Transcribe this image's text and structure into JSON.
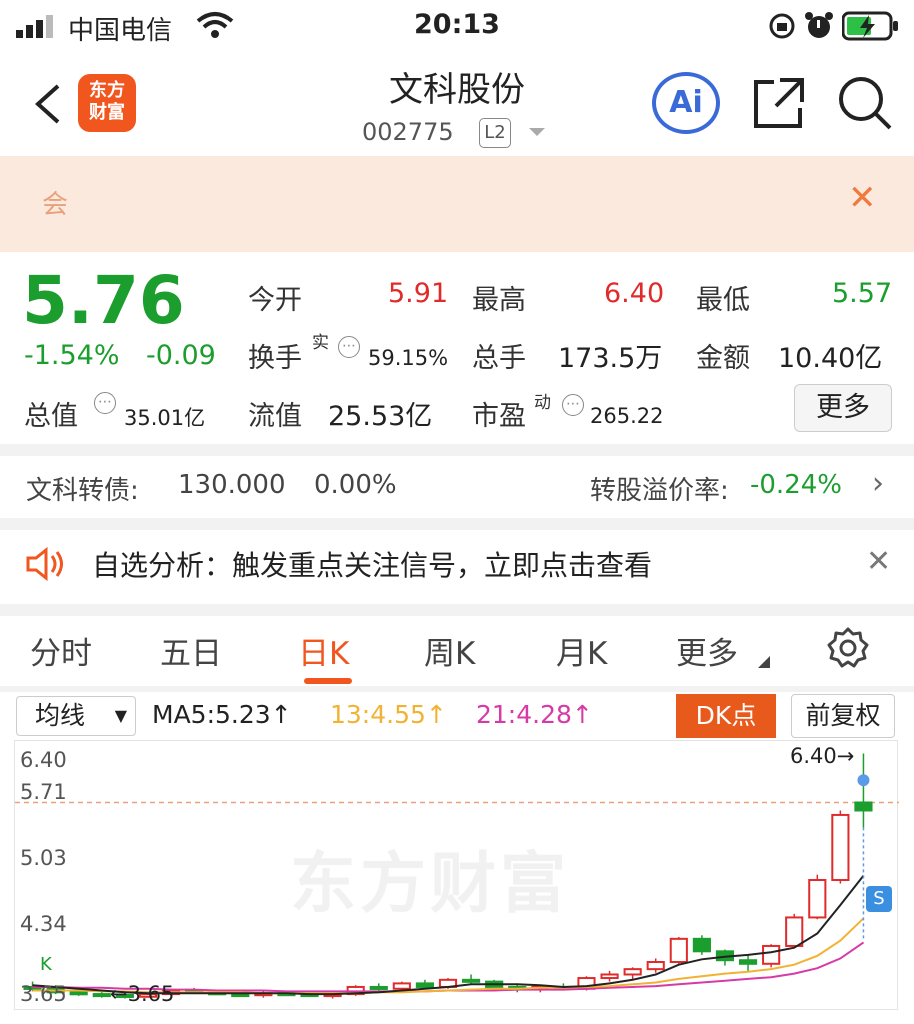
{
  "status_bar": {
    "carrier": "中国电信",
    "time": "20:13"
  },
  "header": {
    "logo_line1": "东方",
    "logo_line2": "财富",
    "title": "文科股份",
    "code": "002775",
    "level": "L2",
    "ai_label": "Ai"
  },
  "notice": {
    "text": "会"
  },
  "quote": {
    "price": "5.76",
    "change_pct": "-1.54%",
    "change": "-0.09",
    "open_label": "今开",
    "open": "5.91",
    "high_label": "最高",
    "high": "6.40",
    "low_label": "最低",
    "low": "5.57",
    "turnover_label": "换手",
    "turnover_sup": "实",
    "turnover": "59.15%",
    "volume_label": "总手",
    "volume": "173.5万",
    "amount_label": "金额",
    "amount": "10.40亿",
    "mktcap_label": "总值",
    "mktcap": "35.01亿",
    "float_label": "流值",
    "float_cap": "25.53亿",
    "pe_label": "市盈",
    "pe_sup": "动",
    "pe": "265.22",
    "more_label": "更多"
  },
  "bond": {
    "label": "文科转债:",
    "price": "130.000",
    "change": "0.00%",
    "premium_label": "转股溢价率:",
    "premium": "-0.24%"
  },
  "alert": {
    "text": "自选分析：触发重点关注信号，立即点击查看"
  },
  "tabs": [
    "分时",
    "五日",
    "日K",
    "周K",
    "月K",
    "更多"
  ],
  "chart_header": {
    "ma_select": "均线",
    "ma5": "MA5:5.23↑",
    "ma13": "13:4.55↑",
    "ma21": "21:4.28↑",
    "dk": "DK点",
    "fq": "前复权"
  },
  "chart_labels": {
    "max_marker": "6.40→",
    "min_marker": "←3.65",
    "s_badge": "S",
    "k_badge": "K",
    "watermark": "东方财富"
  },
  "colors": {
    "up": "#e02b2b",
    "down": "#1b9e2e",
    "accent": "#f0561e",
    "ma5": "#222222",
    "ma13": "#f2b233",
    "ma21": "#d63aa7"
  },
  "chart_data": {
    "type": "candlestick",
    "y_ticks": [
      "6.40",
      "5.71",
      "5.03",
      "4.34",
      "3.65"
    ],
    "ylim": [
      3.6,
      6.45
    ],
    "reference_line": 5.85,
    "candles": [
      {
        "o": 3.78,
        "h": 3.84,
        "l": 3.73,
        "c": 3.76
      },
      {
        "o": 3.76,
        "h": 3.8,
        "l": 3.7,
        "c": 3.72
      },
      {
        "o": 3.72,
        "h": 3.76,
        "l": 3.68,
        "c": 3.7
      },
      {
        "o": 3.7,
        "h": 3.74,
        "l": 3.66,
        "c": 3.69
      },
      {
        "o": 3.69,
        "h": 3.72,
        "l": 3.65,
        "c": 3.67
      },
      {
        "o": 3.67,
        "h": 3.72,
        "l": 3.66,
        "c": 3.7
      },
      {
        "o": 3.7,
        "h": 3.76,
        "l": 3.69,
        "c": 3.74
      },
      {
        "o": 3.74,
        "h": 3.77,
        "l": 3.7,
        "c": 3.72
      },
      {
        "o": 3.72,
        "h": 3.75,
        "l": 3.69,
        "c": 3.7
      },
      {
        "o": 3.7,
        "h": 3.73,
        "l": 3.67,
        "c": 3.69
      },
      {
        "o": 3.69,
        "h": 3.73,
        "l": 3.66,
        "c": 3.71
      },
      {
        "o": 3.71,
        "h": 3.74,
        "l": 3.68,
        "c": 3.7
      },
      {
        "o": 3.7,
        "h": 3.73,
        "l": 3.67,
        "c": 3.68
      },
      {
        "o": 3.68,
        "h": 3.71,
        "l": 3.65,
        "c": 3.7
      },
      {
        "o": 3.7,
        "h": 3.8,
        "l": 3.68,
        "c": 3.78
      },
      {
        "o": 3.78,
        "h": 3.82,
        "l": 3.74,
        "c": 3.76
      },
      {
        "o": 3.76,
        "h": 3.84,
        "l": 3.74,
        "c": 3.82
      },
      {
        "o": 3.82,
        "h": 3.86,
        "l": 3.76,
        "c": 3.78
      },
      {
        "o": 3.78,
        "h": 3.88,
        "l": 3.76,
        "c": 3.86
      },
      {
        "o": 3.86,
        "h": 3.92,
        "l": 3.82,
        "c": 3.84
      },
      {
        "o": 3.84,
        "h": 3.86,
        "l": 3.76,
        "c": 3.78
      },
      {
        "o": 3.78,
        "h": 3.82,
        "l": 3.72,
        "c": 3.76
      },
      {
        "o": 3.76,
        "h": 3.8,
        "l": 3.72,
        "c": 3.78
      },
      {
        "o": 3.78,
        "h": 3.82,
        "l": 3.74,
        "c": 3.76
      },
      {
        "o": 3.76,
        "h": 3.9,
        "l": 3.74,
        "c": 3.88
      },
      {
        "o": 3.88,
        "h": 3.96,
        "l": 3.84,
        "c": 3.92
      },
      {
        "o": 3.92,
        "h": 4.0,
        "l": 3.86,
        "c": 3.98
      },
      {
        "o": 3.98,
        "h": 4.1,
        "l": 3.94,
        "c": 4.06
      },
      {
        "o": 4.06,
        "h": 4.34,
        "l": 4.04,
        "c": 4.32
      },
      {
        "o": 4.32,
        "h": 4.36,
        "l": 4.14,
        "c": 4.18
      },
      {
        "o": 4.18,
        "h": 4.2,
        "l": 4.02,
        "c": 4.08
      },
      {
        "o": 4.08,
        "h": 4.14,
        "l": 3.96,
        "c": 4.04
      },
      {
        "o": 4.04,
        "h": 4.26,
        "l": 4.0,
        "c": 4.24
      },
      {
        "o": 4.24,
        "h": 4.6,
        "l": 4.22,
        "c": 4.56
      },
      {
        "o": 4.56,
        "h": 5.04,
        "l": 4.54,
        "c": 4.98
      },
      {
        "o": 4.98,
        "h": 5.76,
        "l": 4.94,
        "c": 5.71
      },
      {
        "o": 5.85,
        "h": 6.4,
        "l": 5.57,
        "c": 5.76
      }
    ],
    "ma5": [
      3.8,
      3.78,
      3.76,
      3.74,
      3.72,
      3.71,
      3.71,
      3.71,
      3.71,
      3.71,
      3.71,
      3.71,
      3.7,
      3.7,
      3.71,
      3.72,
      3.74,
      3.76,
      3.78,
      3.81,
      3.81,
      3.81,
      3.8,
      3.78,
      3.79,
      3.82,
      3.86,
      3.92,
      4.03,
      4.09,
      4.12,
      4.14,
      4.17,
      4.22,
      4.38,
      4.7,
      5.03
    ],
    "ma13": [
      3.74,
      3.74,
      3.74,
      3.73,
      3.73,
      3.72,
      3.72,
      3.72,
      3.72,
      3.72,
      3.71,
      3.71,
      3.71,
      3.71,
      3.71,
      3.72,
      3.72,
      3.73,
      3.74,
      3.75,
      3.76,
      3.76,
      3.77,
      3.77,
      3.78,
      3.79,
      3.81,
      3.83,
      3.87,
      3.9,
      3.93,
      3.95,
      3.98,
      4.03,
      4.13,
      4.3,
      4.55
    ],
    "ma21": [
      3.78,
      3.78,
      3.77,
      3.77,
      3.76,
      3.76,
      3.75,
      3.75,
      3.74,
      3.74,
      3.74,
      3.73,
      3.73,
      3.73,
      3.73,
      3.73,
      3.73,
      3.73,
      3.74,
      3.74,
      3.74,
      3.75,
      3.75,
      3.75,
      3.76,
      3.77,
      3.78,
      3.79,
      3.81,
      3.83,
      3.85,
      3.87,
      3.89,
      3.93,
      3.99,
      4.1,
      4.28
    ]
  }
}
